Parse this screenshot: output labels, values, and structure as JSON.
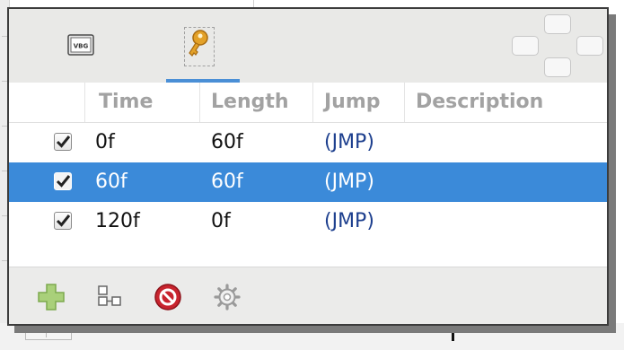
{
  "toolbar": {
    "tabs": [
      {
        "name": "video",
        "icon": "film-clip-icon",
        "glyph": "VBG",
        "active": false
      },
      {
        "name": "keys",
        "icon": "key-icon",
        "active": true
      }
    ],
    "accent_color": "#4a8fd6"
  },
  "table": {
    "columns": [
      "Time",
      "Length",
      "Jump",
      "Description"
    ],
    "rows": [
      {
        "checked": true,
        "time": "0f",
        "length": "60f",
        "jump": "(JMP)",
        "description": "",
        "selected": false
      },
      {
        "checked": true,
        "time": "60f",
        "length": "60f",
        "jump": "(JMP)",
        "description": "",
        "selected": true
      },
      {
        "checked": true,
        "time": "120f",
        "length": "0f",
        "jump": "(JMP)",
        "description": "",
        "selected": false
      }
    ],
    "selection_color": "#3b8ad9"
  },
  "bottom_toolbar": {
    "buttons": [
      "plus-icon",
      "group-icon",
      "stop-icon",
      "gear-icon"
    ]
  }
}
